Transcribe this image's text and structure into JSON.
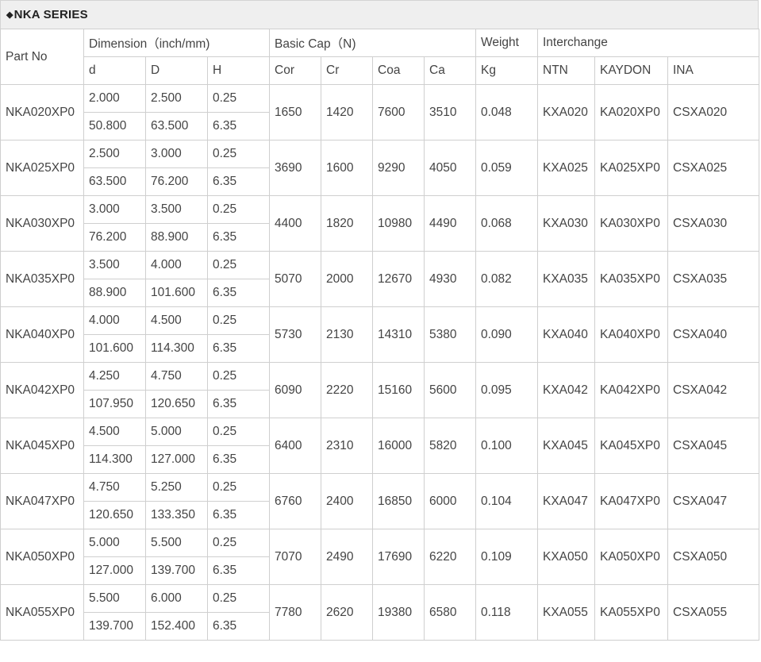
{
  "series_title": "NKA SERIES",
  "headers": {
    "part_no": "Part No",
    "dimension": "Dimension（inch/mm)",
    "basic_cap": "Basic Cap（N)",
    "weight": "Weight",
    "interchange": "Interchange",
    "sub": [
      "d",
      "D",
      "H",
      "Cor",
      "Cr",
      "Coa",
      "Ca",
      "Kg",
      "NTN",
      "KAYDON",
      "INA"
    ]
  },
  "rows": [
    {
      "part": "NKA020XP0",
      "inch": [
        "2.000",
        "2.500",
        "0.25"
      ],
      "mm": [
        "50.800",
        "63.500",
        "6.35"
      ],
      "cor": "1650",
      "cr": "1420",
      "coa": "7600",
      "ca": "3510",
      "kg": "0.048",
      "ntn": "KXA020",
      "kaydon": "KA020XP0",
      "ina": "CSXA020"
    },
    {
      "part": "NKA025XP0",
      "inch": [
        "2.500",
        "3.000",
        "0.25"
      ],
      "mm": [
        "63.500",
        "76.200",
        "6.35"
      ],
      "cor": "3690",
      "cr": "1600",
      "coa": "9290",
      "ca": "4050",
      "kg": "0.059",
      "ntn": "KXA025",
      "kaydon": "KA025XP0",
      "ina": "CSXA025"
    },
    {
      "part": "NKA030XP0",
      "inch": [
        "3.000",
        "3.500",
        "0.25"
      ],
      "mm": [
        "76.200",
        "88.900",
        "6.35"
      ],
      "cor": "4400",
      "cr": "1820",
      "coa": "10980",
      "ca": "4490",
      "kg": "0.068",
      "ntn": "KXA030",
      "kaydon": "KA030XP0",
      "ina": "CSXA030"
    },
    {
      "part": "NKA035XP0",
      "inch": [
        "3.500",
        "4.000",
        "0.25"
      ],
      "mm": [
        "88.900",
        "101.600",
        "6.35"
      ],
      "cor": "5070",
      "cr": "2000",
      "coa": "12670",
      "ca": "4930",
      "kg": "0.082",
      "ntn": "KXA035",
      "kaydon": "KA035XP0",
      "ina": "CSXA035"
    },
    {
      "part": "NKA040XP0",
      "inch": [
        "4.000",
        "4.500",
        "0.25"
      ],
      "mm": [
        "101.600",
        "114.300",
        "6.35"
      ],
      "cor": "5730",
      "cr": "2130",
      "coa": "14310",
      "ca": "5380",
      "kg": "0.090",
      "ntn": "KXA040",
      "kaydon": "KA040XP0",
      "ina": "CSXA040"
    },
    {
      "part": "NKA042XP0",
      "inch": [
        "4.250",
        "4.750",
        "0.25"
      ],
      "mm": [
        "107.950",
        "120.650",
        "6.35"
      ],
      "cor": "6090",
      "cr": "2220",
      "coa": "15160",
      "ca": "5600",
      "kg": "0.095",
      "ntn": "KXA042",
      "kaydon": "KA042XP0",
      "ina": "CSXA042"
    },
    {
      "part": "NKA045XP0",
      "inch": [
        "4.500",
        "5.000",
        "0.25"
      ],
      "mm": [
        "114.300",
        "127.000",
        "6.35"
      ],
      "cor": "6400",
      "cr": "2310",
      "coa": "16000",
      "ca": "5820",
      "kg": "0.100",
      "ntn": "KXA045",
      "kaydon": "KA045XP0",
      "ina": "CSXA045"
    },
    {
      "part": "NKA047XP0",
      "inch": [
        "4.750",
        "5.250",
        "0.25"
      ],
      "mm": [
        "120.650",
        "133.350",
        "6.35"
      ],
      "cor": "6760",
      "cr": "2400",
      "coa": "16850",
      "ca": "6000",
      "kg": "0.104",
      "ntn": "KXA047",
      "kaydon": "KA047XP0",
      "ina": "CSXA047"
    },
    {
      "part": "NKA050XP0",
      "inch": [
        "5.000",
        "5.500",
        "0.25"
      ],
      "mm": [
        "127.000",
        "139.700",
        "6.35"
      ],
      "cor": "7070",
      "cr": "2490",
      "coa": "17690",
      "ca": "6220",
      "kg": "0.109",
      "ntn": "KXA050",
      "kaydon": "KA050XP0",
      "ina": "CSXA050"
    },
    {
      "part": "NKA055XP0",
      "inch": [
        "5.500",
        "6.000",
        "0.25"
      ],
      "mm": [
        "139.700",
        "152.400",
        "6.35"
      ],
      "cor": "7780",
      "cr": "2620",
      "coa": "19380",
      "ca": "6580",
      "kg": "0.118",
      "ntn": "KXA055",
      "kaydon": "KA055XP0",
      "ina": "CSXA055"
    }
  ]
}
